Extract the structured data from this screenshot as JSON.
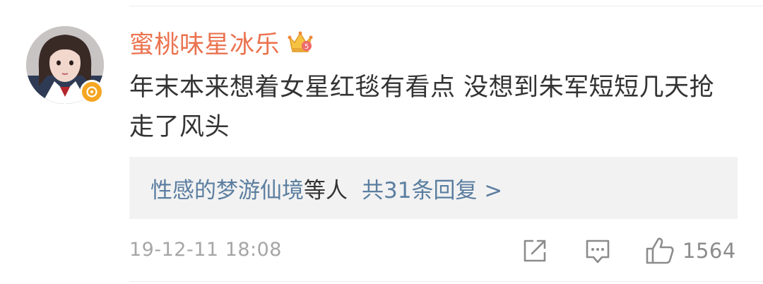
{
  "post": {
    "username": "蜜桃味星冰乐",
    "username_color": "#eb7350",
    "member_icon": "crown-icon",
    "verified_icon": "verified-badge-icon",
    "text": "年末本来想着女星红毯有看点 没想到朱军短短几天抢走了风头",
    "replies": {
      "users": "性感的梦游仙境",
      "suffix": "等人",
      "count_label": "共31条回复 >"
    },
    "timestamp": "19-12-11 18:08",
    "actions": {
      "share_icon": "share-icon",
      "comment_icon": "comment-icon",
      "like_icon": "thumbs-up-icon",
      "like_count": "1564"
    }
  }
}
